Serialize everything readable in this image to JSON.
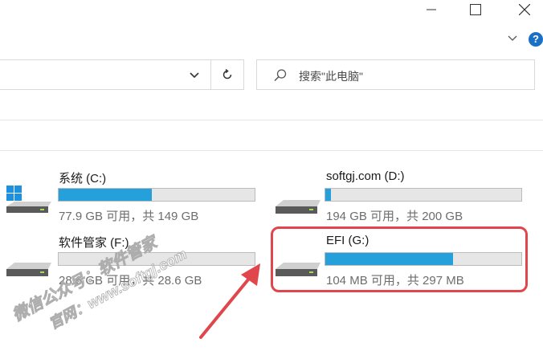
{
  "window": {
    "minimize_icon": "minimize-icon",
    "maximize_icon": "maximize-icon",
    "close_icon": "close-icon"
  },
  "ribbon": {
    "expand_icon": "chevron-down-icon",
    "help_label": "?"
  },
  "address": {
    "dropdown_icon": "chevron-down-icon",
    "refresh_icon": "refresh-icon"
  },
  "search": {
    "placeholder": "搜索\"此电脑\""
  },
  "drives": [
    {
      "name": "系统 (C:)",
      "used_fraction": 0.474,
      "info": "77.9 GB 可用，共 149 GB",
      "icon": "windows-drive-icon"
    },
    {
      "name": "softgj.com (D:)",
      "used_fraction": 0.03,
      "info": "194 GB 可用，共 200 GB",
      "icon": "hard-drive-icon"
    },
    {
      "name": "软件管家 (F:)",
      "used_fraction": 0.0,
      "info": "28.6 GB 可用，共 28.6 GB",
      "icon": "hard-drive-icon"
    },
    {
      "name": "EFI (G:)",
      "used_fraction": 0.65,
      "info": "104 MB 可用，共 297 MB",
      "icon": "hard-drive-icon"
    }
  ],
  "watermark": {
    "line1": "微信公众号：软件管家",
    "line2": "官网：www.softgj.com"
  },
  "colors": {
    "bar_fill": "#26a0da",
    "highlight": "#e0464b",
    "help": "#1a70c6"
  }
}
